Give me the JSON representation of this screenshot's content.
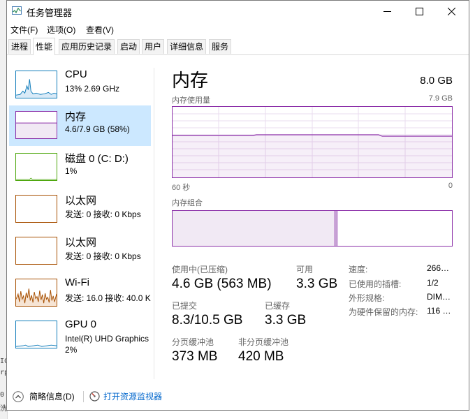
{
  "window": {
    "title": "任务管理器"
  },
  "background_text": [
    "IC",
    "rp",
    "0",
    "洗"
  ],
  "menu": [
    "文件(F)",
    "选项(O)",
    "查看(V)"
  ],
  "tabs": [
    "进程",
    "性能",
    "应用历史记录",
    "启动",
    "用户",
    "详细信息",
    "服务"
  ],
  "sidebar": [
    {
      "title": "CPU",
      "sub": "13% 2.69 GHz",
      "sub2": ""
    },
    {
      "title": "内存",
      "sub": "4.6/7.9 GB (58%)",
      "sub2": ""
    },
    {
      "title": "磁盘 0 (C: D:)",
      "sub": "1%",
      "sub2": ""
    },
    {
      "title": "以太网",
      "sub": "发送: 0 接收: 0 Kbps",
      "sub2": ""
    },
    {
      "title": "以太网",
      "sub": "发送: 0 接收: 0 Kbps",
      "sub2": ""
    },
    {
      "title": "Wi-Fi",
      "sub": "发送: 16.0 接收: 40.0 K",
      "sub2": ""
    },
    {
      "title": "GPU 0",
      "sub": "Intel(R) UHD Graphics",
      "sub2": "2%"
    }
  ],
  "main": {
    "title": "内存",
    "total": "8.0 GB",
    "usage_label": "内存使用量",
    "usage_max": "7.9 GB",
    "time_left": "60 秒",
    "time_right": "0",
    "composition_label": "内存组合",
    "usage_fraction": 0.58,
    "stats": [
      {
        "label": "使用中(已压缩)",
        "value": "4.6 GB (563 MB)"
      },
      {
        "label": "可用",
        "value": "3.3 GB"
      },
      {
        "label": "已提交",
        "value": "8.3/10.5 GB"
      },
      {
        "label": "已缓存",
        "value": "3.3 GB"
      },
      {
        "label": "分页缓冲池",
        "value": "373 MB"
      },
      {
        "label": "非分页缓冲池",
        "value": "420 MB"
      }
    ],
    "details": [
      {
        "label": "速度:",
        "value": "266…"
      },
      {
        "label": "已使用的插槽:",
        "value": "1/2"
      },
      {
        "label": "外形规格:",
        "value": "DIM…"
      },
      {
        "label": "为硬件保留的内存:",
        "value": "116 …"
      }
    ]
  },
  "footer": {
    "less": "简略信息(D)",
    "monitor": "打开资源监视器"
  },
  "colors": {
    "memory": "#8b2fa8",
    "cpu": "#117dbb",
    "disk": "#4da60c",
    "ethernet": "#a74f01",
    "gpu": "#117dbb",
    "selected": "#cce8ff"
  }
}
